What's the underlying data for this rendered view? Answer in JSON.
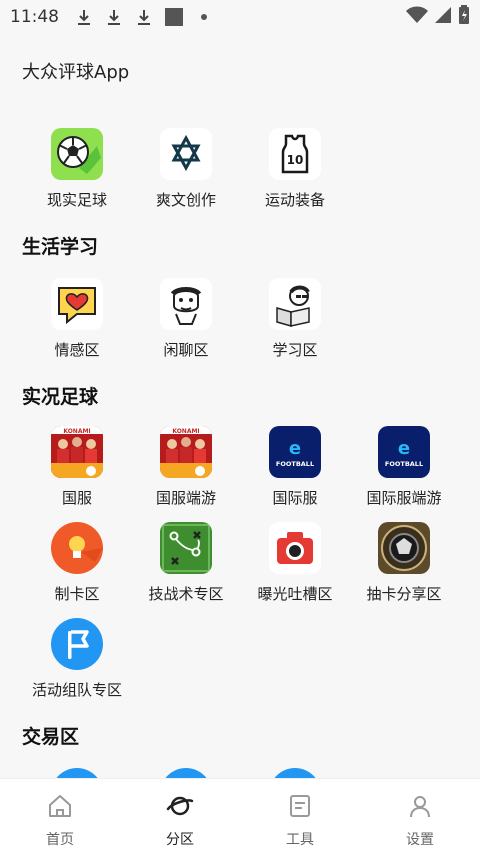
{
  "status_bar": {
    "time": "11:48"
  },
  "app": {
    "title": "大众评球App"
  },
  "sections": {
    "top": {
      "items": [
        {
          "label": "现实足球",
          "icon": "soccer-ball-icon"
        },
        {
          "label": "爽文创作",
          "icon": "star-of-david-icon"
        },
        {
          "label": "运动装备",
          "icon": "jersey-icon"
        }
      ]
    },
    "life": {
      "title": "生活学习",
      "items": [
        {
          "label": "情感区",
          "icon": "heart-bubble-icon"
        },
        {
          "label": "闲聊区",
          "icon": "meme-face-icon"
        },
        {
          "label": "学习区",
          "icon": "reading-meme-icon"
        }
      ]
    },
    "pes": {
      "title": "实况足球",
      "items": [
        {
          "label": "国服",
          "icon": "konami-players-icon"
        },
        {
          "label": "国服端游",
          "icon": "konami-players-icon"
        },
        {
          "label": "国际服",
          "icon": "efootball-icon"
        },
        {
          "label": "国际服端游",
          "icon": "efootball-icon"
        },
        {
          "label": "制卡区",
          "icon": "lightbulb-icon"
        },
        {
          "label": "技战术专区",
          "icon": "tactics-board-icon"
        },
        {
          "label": "曝光吐槽区",
          "icon": "camera-icon"
        },
        {
          "label": "抽卡分享区",
          "icon": "card-coin-icon"
        },
        {
          "label": "活动组队专区",
          "icon": "flag-icon"
        }
      ]
    },
    "trade": {
      "title": "交易区"
    }
  },
  "icon_text": {
    "jersey_number": "10",
    "efootball": "FOOTBALL",
    "konami": "KONAMI"
  },
  "bottom_nav": [
    {
      "label": "首页",
      "icon": "home-icon",
      "active": false
    },
    {
      "label": "分区",
      "icon": "planet-icon",
      "active": true
    },
    {
      "label": "工具",
      "icon": "tools-doc-icon",
      "active": false
    },
    {
      "label": "设置",
      "icon": "person-icon",
      "active": false
    }
  ],
  "colors": {
    "accent_blue": "#2196f3",
    "orange": "#f05a28",
    "green": "#3e8e2f",
    "red": "#e53935",
    "navy": "#0a1f6b"
  }
}
